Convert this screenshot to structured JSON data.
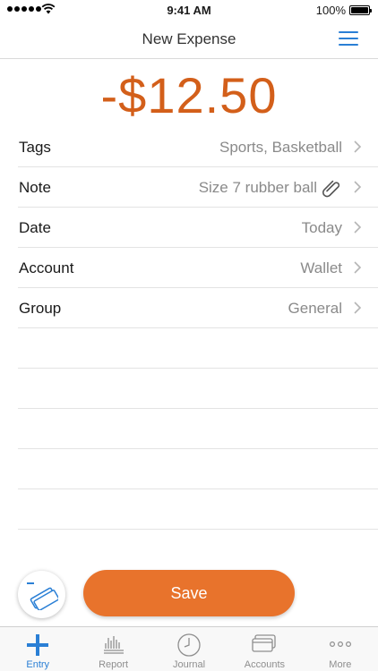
{
  "status_bar": {
    "time": "9:41 AM",
    "battery": "100%"
  },
  "nav": {
    "title": "New Expense"
  },
  "amount": "-$12.50",
  "rows": [
    {
      "label": "Tags",
      "value": "Sports, Basketball"
    },
    {
      "label": "Note",
      "value": "Size 7 rubber ball"
    },
    {
      "label": "Date",
      "value": "Today"
    },
    {
      "label": "Account",
      "value": "Wallet"
    },
    {
      "label": "Group",
      "value": "General"
    }
  ],
  "save_label": "Save",
  "tabs": [
    {
      "label": "Entry",
      "icon": "plus-icon",
      "active": true
    },
    {
      "label": "Report",
      "icon": "report-icon"
    },
    {
      "label": "Journal",
      "icon": "clock-icon"
    },
    {
      "label": "Accounts",
      "icon": "cards-icon"
    },
    {
      "label": "More",
      "icon": "more-dots-icon"
    }
  ],
  "colors": {
    "accent": "#2a7fd5",
    "amount": "#d35f1a",
    "save": "#e8732c"
  }
}
